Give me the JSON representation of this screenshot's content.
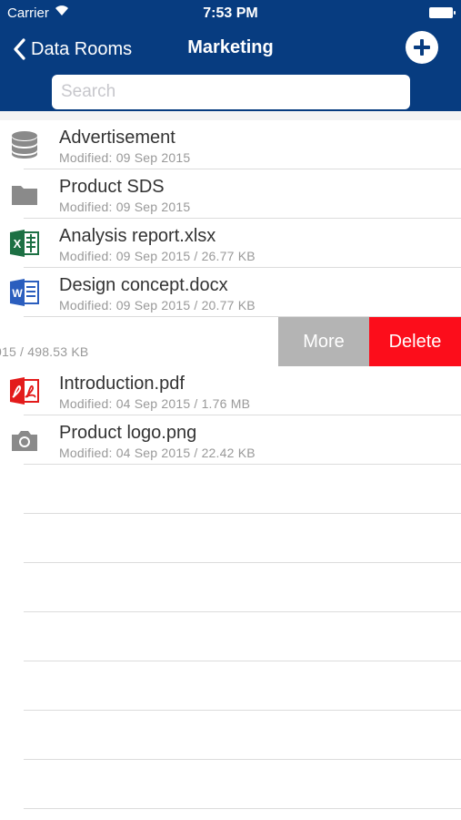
{
  "status_bar": {
    "carrier": "Carrier",
    "time": "7:53 PM"
  },
  "nav": {
    "back_label": "Data Rooms",
    "title": "Marketing"
  },
  "search": {
    "placeholder": "Search"
  },
  "files": [
    {
      "name": "Advertisement",
      "meta": "Modified: 09 Sep 2015",
      "icon": "database-icon"
    },
    {
      "name": "Product SDS",
      "meta": "Modified: 09 Sep 2015",
      "icon": "folder-icon"
    },
    {
      "name": "Analysis report.xlsx",
      "meta": "Modified: 09 Sep 2015 / 26.77 KB",
      "icon": "excel-icon"
    },
    {
      "name": "Design concept.docx",
      "meta": "Modified: 09 Sep 2015 / 20.77 KB",
      "icon": "word-icon"
    }
  ],
  "swiped_row": {
    "meta": "015 / 498.53 KB",
    "more_label": "More",
    "delete_label": "Delete"
  },
  "files_after": [
    {
      "name": "Introduction.pdf",
      "meta": "Modified: 04 Sep 2015 / 1.76 MB",
      "icon": "pdf-icon"
    },
    {
      "name": "Product logo.png",
      "meta": "Modified: 04 Sep 2015 / 22.42 KB",
      "icon": "camera-icon"
    }
  ],
  "colors": {
    "nav_bar": "#073c80",
    "more_button": "#b4b4b4",
    "delete_button": "#fc0d1b",
    "excel": "#1d7044",
    "word": "#2b5ebe",
    "pdf": "#e31b1b"
  }
}
